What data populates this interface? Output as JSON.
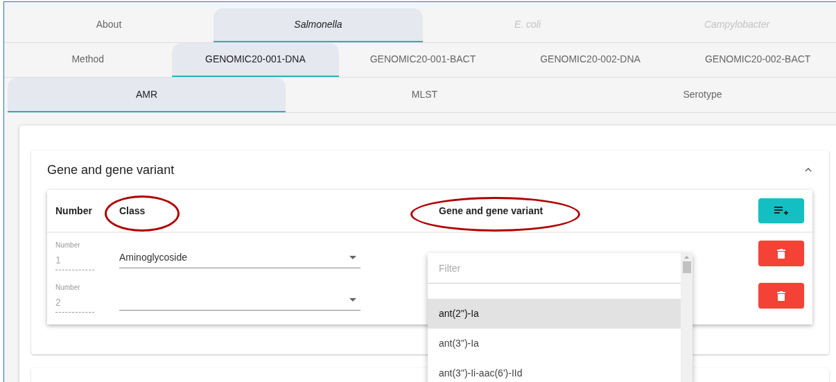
{
  "species_tabs": [
    {
      "label": "About",
      "selected": false,
      "disabled": false,
      "kind": "plain"
    },
    {
      "label": "Salmonella",
      "selected": true,
      "disabled": false,
      "kind": "taxon"
    },
    {
      "label": "E. coli",
      "selected": false,
      "disabled": true,
      "kind": "taxon"
    },
    {
      "label": "Campylobacter",
      "selected": false,
      "disabled": true,
      "kind": "taxon"
    }
  ],
  "sample_tabs": [
    {
      "label": "Method",
      "selected": false
    },
    {
      "label": "GENOMIC20-001-DNA",
      "selected": true
    },
    {
      "label": "GENOMIC20-001-BACT",
      "selected": false
    },
    {
      "label": "GENOMIC20-002-DNA",
      "selected": false
    },
    {
      "label": "GENOMIC20-002-BACT",
      "selected": false
    }
  ],
  "analysis_tabs": [
    {
      "label": "AMR",
      "selected": true
    },
    {
      "label": "MLST",
      "selected": false
    },
    {
      "label": "Serotype",
      "selected": false
    }
  ],
  "panel": {
    "title": "Gene and gene variant",
    "expanded": true,
    "table": {
      "columns": [
        "Number",
        "Class",
        "Gene and gene variant"
      ],
      "rows": [
        {
          "number_label": "Number",
          "number": "1",
          "class": "Aminoglycoside"
        },
        {
          "number_label": "Number",
          "number": "2",
          "class": ""
        }
      ]
    }
  },
  "gene_dropdown": {
    "placeholder": "Filter",
    "options": [
      {
        "label": "ant(2\")-Ia",
        "selected": true
      },
      {
        "label": "ant(3\")-Ia",
        "selected": false
      },
      {
        "label": "ant(3\")-Ii-aac(6')-IId",
        "selected": false
      }
    ]
  }
}
